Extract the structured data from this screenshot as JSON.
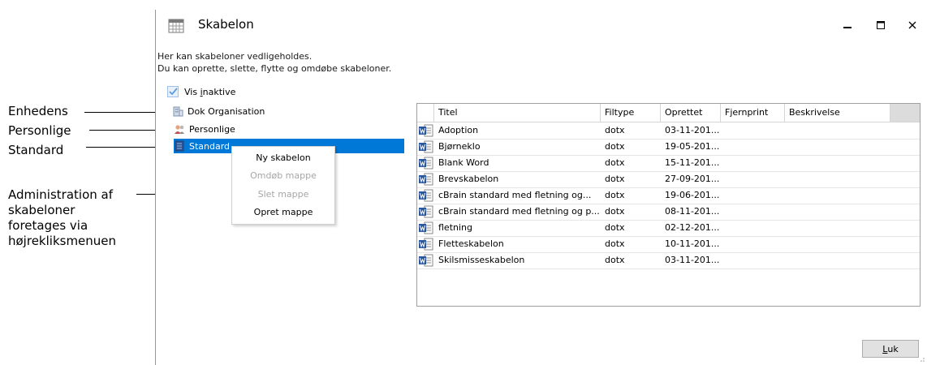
{
  "annotations": {
    "enhedens": "Enhedens",
    "personlige": "Personlige",
    "standard": "Standard",
    "admin_lines": [
      "Administration af",
      "skabeloner",
      "foretages via",
      "højrekliksmenuen"
    ]
  },
  "window": {
    "title": "Skabelon",
    "icon": "calendar-grid-icon",
    "controls": [
      "minimize-icon",
      "maximize-icon",
      "close-icon"
    ]
  },
  "description": {
    "line1": "Her kan skabeloner vedligeholdes.",
    "line2": "Du kan oprette, slette, flytte og omdøbe skabeloner."
  },
  "vis_inaktive": {
    "label_first": "Vis ",
    "label_underlined": "i",
    "label_rest": "naktive",
    "checked": true
  },
  "tree": {
    "items": [
      {
        "label": "Dok Organisation",
        "icon": "building-icon"
      },
      {
        "label": "Personlige",
        "icon": "users-icon"
      },
      {
        "label": "Standard",
        "icon": "document-icon",
        "selected": true
      }
    ]
  },
  "context_menu": {
    "items": [
      {
        "label": "Ny skabelon",
        "enabled": true
      },
      {
        "label": "Omdøb mappe",
        "enabled": false
      },
      {
        "label": "Slet mappe",
        "enabled": false
      },
      {
        "label": "Opret mappe",
        "enabled": true
      }
    ]
  },
  "grid": {
    "columns": [
      "Titel",
      "Filtype",
      "Oprettet",
      "Fjernprint",
      "Beskrivelse"
    ],
    "rows": [
      {
        "titel": "Adoption",
        "filtype": "dotx",
        "oprettet": "03-11-201..."
      },
      {
        "titel": "Bjørneklo",
        "filtype": "dotx",
        "oprettet": "19-05-201..."
      },
      {
        "titel": "Blank Word",
        "filtype": "dotx",
        "oprettet": "15-11-201..."
      },
      {
        "titel": "Brevskabelon",
        "filtype": "dotx",
        "oprettet": "27-09-201..."
      },
      {
        "titel": "cBrain standard med fletning og...",
        "filtype": "dotx",
        "oprettet": "19-06-201..."
      },
      {
        "titel": "cBrain standard med fletning og p...",
        "filtype": "dotx",
        "oprettet": "08-11-201..."
      },
      {
        "titel": "fletning",
        "filtype": "dotx",
        "oprettet": "02-12-201..."
      },
      {
        "titel": "Fletteskabelon",
        "filtype": "dotx",
        "oprettet": "10-11-201..."
      },
      {
        "titel": "Skilsmisseskabelon",
        "filtype": "dotx",
        "oprettet": "03-11-201..."
      }
    ]
  },
  "buttons": {
    "luk_underlined": "L",
    "luk_rest": "uk"
  },
  "colors": {
    "selection": "#0078d7",
    "word_icon": "#2b579a",
    "checkbox_check": "#5a9ee0"
  }
}
